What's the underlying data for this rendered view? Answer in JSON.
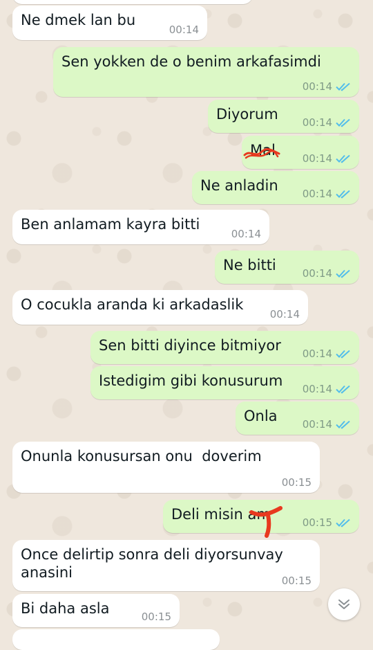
{
  "chat": {
    "messages": [
      {
        "dir": "in",
        "text": "Ne dmek lan bu",
        "time": "00:14"
      },
      {
        "dir": "out",
        "text": "Sen yokken de o benim arkafasimdi",
        "time": "00:14",
        "read": true
      },
      {
        "dir": "out",
        "text": "Diyorum",
        "time": "00:14",
        "read": true
      },
      {
        "dir": "out",
        "text": "Mal",
        "time": "00:14",
        "read": true,
        "scribbled": true
      },
      {
        "dir": "out",
        "text": "Ne anladin",
        "time": "00:14",
        "read": true
      },
      {
        "dir": "in",
        "text": "Ben anlamam kayra bitti",
        "time": "00:14"
      },
      {
        "dir": "out",
        "text": "Ne bitti",
        "time": "00:14",
        "read": true
      },
      {
        "dir": "in",
        "text": "O cocukla aranda ki arkadaslik",
        "time": "00:14"
      },
      {
        "dir": "out",
        "text": "Sen bitti diyince bitmiyor",
        "time": "00:14",
        "read": true
      },
      {
        "dir": "out",
        "text": "Istedigim gibi konusurum",
        "time": "00:14",
        "read": true
      },
      {
        "dir": "out",
        "text": "Onla",
        "time": "00:14",
        "read": true
      },
      {
        "dir": "in",
        "text": "Onunla konusursan onu  doverim",
        "time": "00:15"
      },
      {
        "dir": "out",
        "text": "Deli misin am",
        "time": "00:15",
        "read": true,
        "scribbled": true
      },
      {
        "dir": "in",
        "text": "Once delirtip sonra deli diyorsunvay\nanasini",
        "time": "00:15"
      },
      {
        "dir": "in",
        "text": "Bi daha asla",
        "time": "00:15"
      }
    ]
  },
  "colors": {
    "incoming_bubble": "#ffffff",
    "outgoing_bubble": "#dcf8c6",
    "read_ticks": "#53bdeb",
    "scribble": "#e8391f",
    "background": "#efe7dd"
  },
  "icons": {
    "read_receipt": "double-check-icon",
    "scroll_down": "chevron-down-icon"
  }
}
